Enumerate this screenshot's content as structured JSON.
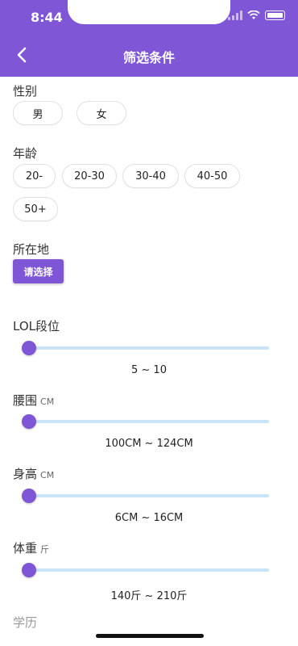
{
  "status": {
    "time": "8:44"
  },
  "nav": {
    "title": "筛选条件"
  },
  "gender": {
    "label": "性别",
    "options": [
      "男",
      "女"
    ]
  },
  "age": {
    "label": "年龄",
    "options": [
      "20-",
      "20-30",
      "30-40",
      "40-50",
      "50+"
    ]
  },
  "location": {
    "label": "所在地",
    "button": "请选择"
  },
  "lol": {
    "label": "LOL段位",
    "range": "5 ~ 10"
  },
  "waist": {
    "label": "腰围",
    "unit": "CM",
    "range": "100CM ~ 124CM"
  },
  "height": {
    "label": "身高",
    "unit": "CM",
    "range": "6CM ~ 16CM"
  },
  "weight": {
    "label": "体重",
    "unit": "斤",
    "range": "140斤 ~ 210斤"
  },
  "next_section": {
    "label": "学历"
  },
  "colors": {
    "accent": "#7e56d6",
    "track": "#c9e4f7"
  }
}
